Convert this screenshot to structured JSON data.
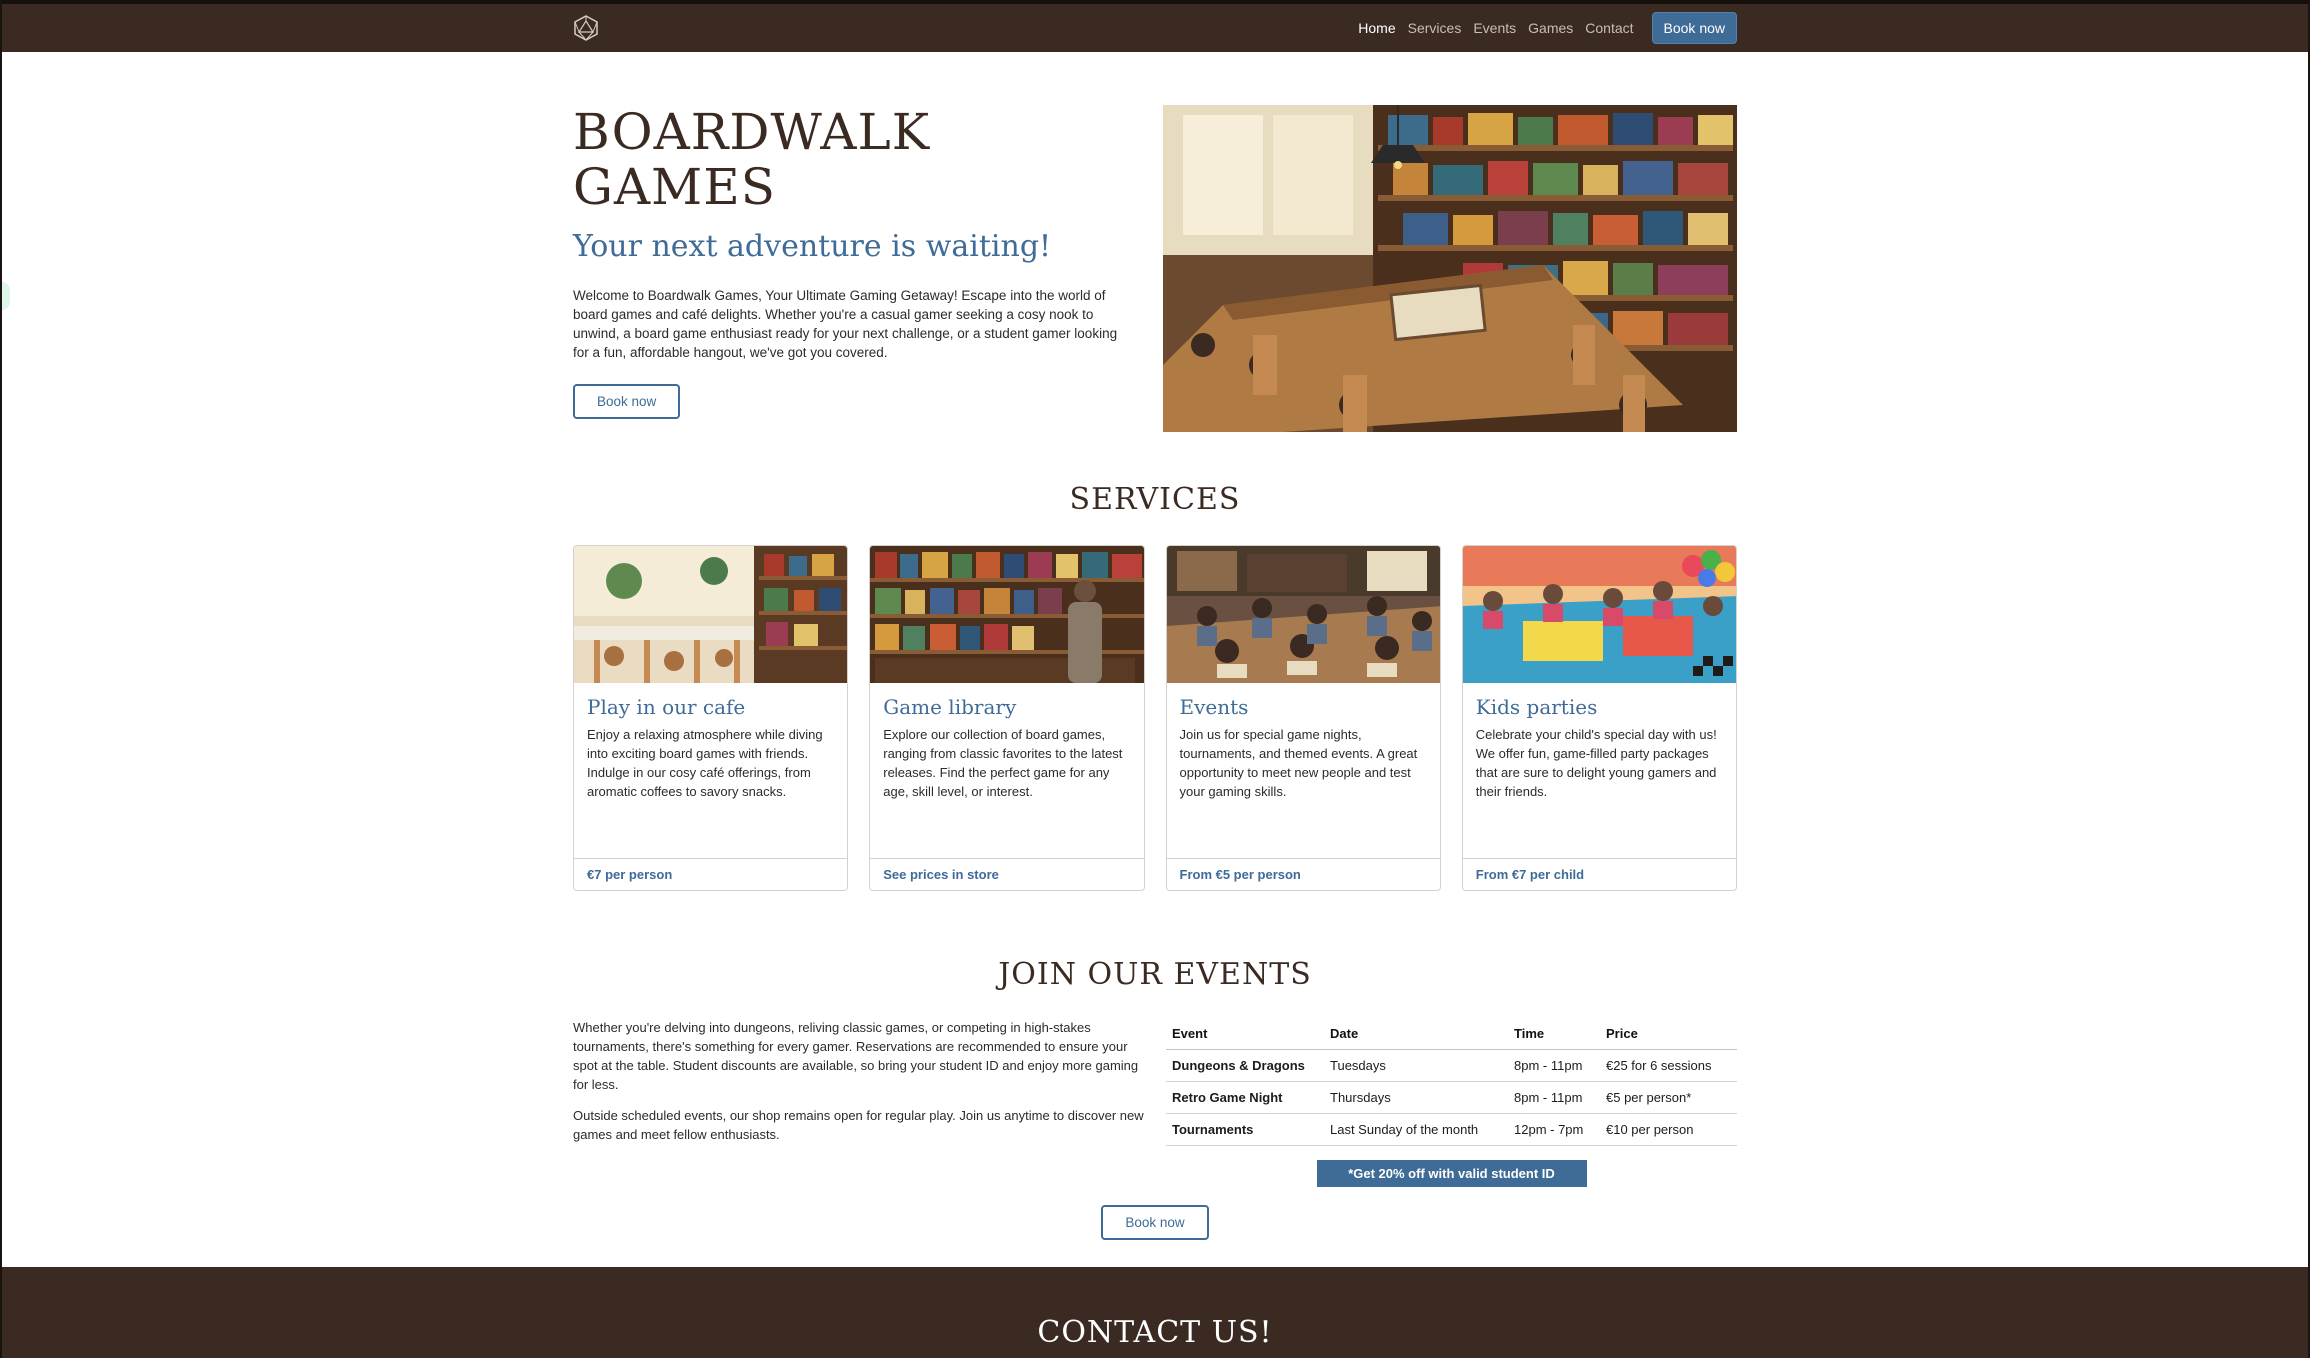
{
  "nav": {
    "logo_icon": "d20-dice-icon",
    "links": [
      "Home",
      "Services",
      "Events",
      "Games",
      "Contact"
    ],
    "active": "Home",
    "cta": "Book now"
  },
  "hero": {
    "title": "BOARDWALK GAMES",
    "subtitle": "Your next adventure is waiting!",
    "body": "Welcome to Boardwalk Games, Your Ultimate Gaming Getaway! Escape into the world of board games and café delights. Whether you're a casual gamer seeking a cosy nook to unwind, a board game enthusiast ready for your next challenge, or a student gamer looking for a fun, affordable hangout, we've got you covered.",
    "button": "Book now"
  },
  "services": {
    "title": "SERVICES",
    "cards": [
      {
        "title": "Play in our cafe",
        "text": "Enjoy a relaxing atmosphere while diving into exciting board games with friends. Indulge in our cosy café offerings, from aromatic coffees to savory snacks.",
        "price": "€7 per person"
      },
      {
        "title": "Game library",
        "text": "Explore our collection of board games, ranging from classic favorites to the latest releases. Find the perfect game for any age, skill level, or interest.",
        "price": "See prices in store"
      },
      {
        "title": "Events",
        "text": "Join us for special game nights, tournaments, and themed events. A great opportunity to meet new people and test your gaming skills.",
        "price": "From €5 per person"
      },
      {
        "title": "Kids parties",
        "text": "Celebrate your child's special day with us! We offer fun, game-filled party packages that are sure to delight young gamers and their friends.",
        "price": "From €7 per child"
      }
    ]
  },
  "events": {
    "title": "JOIN OUR EVENTS",
    "para1": "Whether you're delving into dungeons, reliving classic games, or competing in high-stakes tournaments, there's something for every gamer. Reservations are recommended to ensure your spot at the table. Student discounts are available, so bring your student ID and enjoy more gaming for less.",
    "para2": "Outside scheduled events, our shop remains open for regular play. Join us anytime to discover new games and meet fellow enthusiasts.",
    "table": {
      "headers": [
        "Event",
        "Date",
        "Time",
        "Price"
      ],
      "rows": [
        [
          "Dungeons & Dragons",
          "Tuesdays",
          "8pm - 11pm",
          "€25 for 6 sessions"
        ],
        [
          "Retro Game Night",
          "Thursdays",
          "8pm - 11pm",
          "€5 per person*"
        ],
        [
          "Tournaments",
          "Last Sunday of the month",
          "12pm - 7pm",
          "€10 per person"
        ]
      ]
    },
    "discount": "*Get 20% off with valid student ID",
    "button": "Book now"
  },
  "contact": {
    "title": "CONTACT US!"
  },
  "colors": {
    "brand_dark": "#3a2a22",
    "accent_blue": "#3f6b97"
  }
}
